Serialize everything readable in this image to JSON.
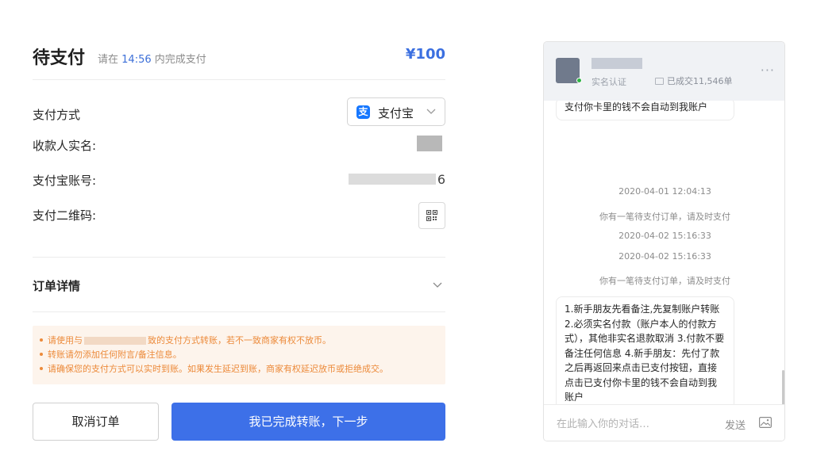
{
  "payment": {
    "title": "待支付",
    "tip_prefix": "请在",
    "countdown": "14:56",
    "tip_suffix": "内完成支付",
    "amount": "¥100",
    "method_label": "支付方式",
    "method_value": "支付宝",
    "method_icon": "支",
    "payee_label": "收款人实名:",
    "account_label": "支付宝账号:",
    "account_tail": "6",
    "qr_label": "支付二维码:",
    "details_label": "订单详情"
  },
  "notice": {
    "line1_a": "请使用与",
    "line1_b": "致的支付方式转账，若不一致商家有权不放币。",
    "line2": "转账请勿添加任何附言/备注信息。",
    "line3": "请确保您的支付方式可以实时到账。如果发生延迟到账，商家有权延迟放币或拒绝成交。"
  },
  "buttons": {
    "cancel": "取消订单",
    "next": "我已完成转账，下一步"
  },
  "chat": {
    "verified": "实名认证",
    "deals": "已成交11,546单",
    "more": "···",
    "bubble_top": "支付你卡里的钱不会自动到我账户",
    "messages": [
      "2020-04-01 12:04:13",
      "你有一笔待支付订单，请及时支付",
      "2020-04-02 15:16:33",
      "2020-04-02 15:16:33",
      "你有一笔待支付订单，请及时支付"
    ],
    "bubble_main": "1.新手朋友先看备注,先复制账户转账 2.必须实名付款（账户本人的付款方式），其他非实名退款取消 3.付款不要备注任何信息 4.新手朋友：先付了款之后再返回来点击已支付按钮，直接点击已支付你卡里的钱不会自动到我账户",
    "input_placeholder": "在此输入你的对话…",
    "send": "发送"
  },
  "colors": {
    "primary": "#3d70e8",
    "amount": "#3b6fe0",
    "notice_text": "#ec8a3a",
    "notice_bg": "#fdf4ec",
    "alipay": "#1677ff",
    "online": "#2fb344"
  },
  "icons": {
    "alipay": "alipay-icon",
    "select_chevron": "chevron-down-icon",
    "qr": "qr-code-icon",
    "details_chevron": "chevron-down-icon",
    "online": "online-dot-icon",
    "deals": "order-icon",
    "more": "more-icon",
    "image": "image-icon"
  }
}
